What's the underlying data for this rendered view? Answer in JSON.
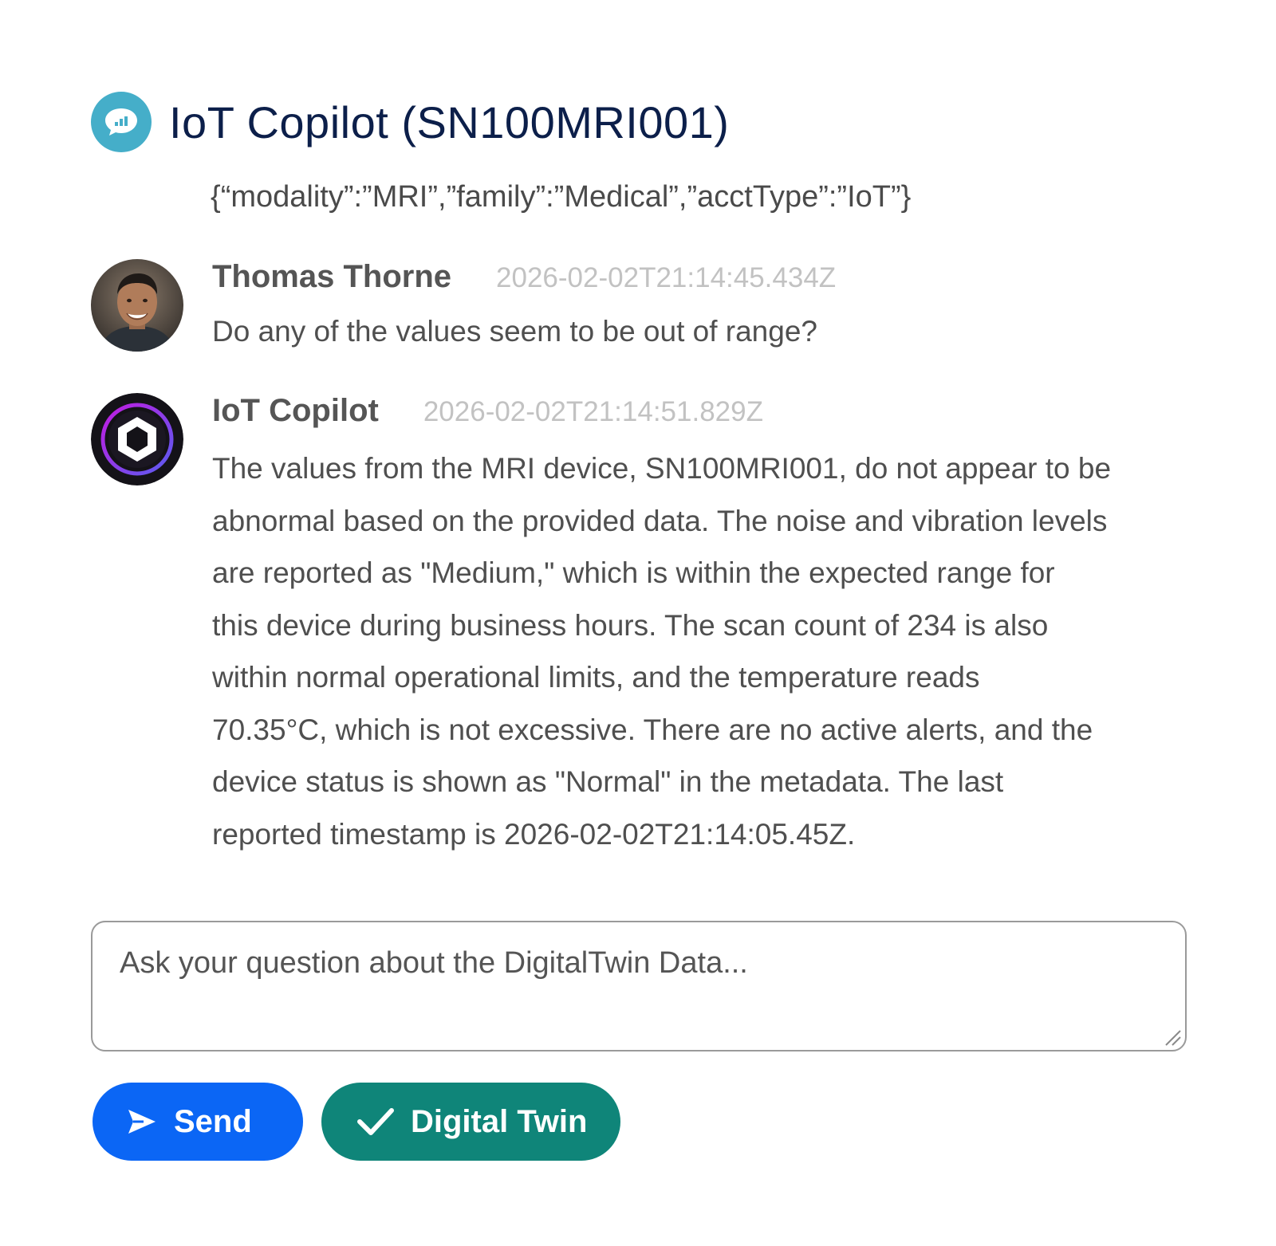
{
  "header": {
    "title": "IoT Copilot (SN100MRI001)",
    "icon": "chat-bubble-icon",
    "icon_color": "#45aec9",
    "meta_json": "{“modality”:”MRI”,”family”:”Medical”,”acctType”:”IoT”}"
  },
  "messages": [
    {
      "author": "Thomas Thorne",
      "timestamp": "2026-02-02T21:14:45.434Z",
      "avatar": "user-photo-avatar",
      "text": "Do any of the values seem to be out of range?"
    },
    {
      "author": "IoT Copilot",
      "timestamp": "2026-02-02T21:14:51.829Z",
      "avatar": "copilot-logo-avatar",
      "lines": [
        "The values from the MRI device, SN100MRI001, do not appear to be",
        "abnormal based on the provided data. The noise and vibration levels",
        "are reported as \"Medium,\" which is within the expected range for",
        "this device during business hours. The scan count of 234 is also",
        "within normal operational limits, and the temperature reads",
        "70.35°C, which is not excessive. There are no active alerts, and the",
        "device status is shown as \"Normal\" in the metadata. The last",
        "reported timestamp is 2026-02-02T21:14:05.45Z."
      ]
    }
  ],
  "input": {
    "placeholder": "Ask your question about the DigitalTwin Data..."
  },
  "buttons": {
    "send_label": "Send",
    "send_color": "#0b66f5",
    "twin_label": "Digital Twin",
    "twin_color": "#0f8579"
  }
}
